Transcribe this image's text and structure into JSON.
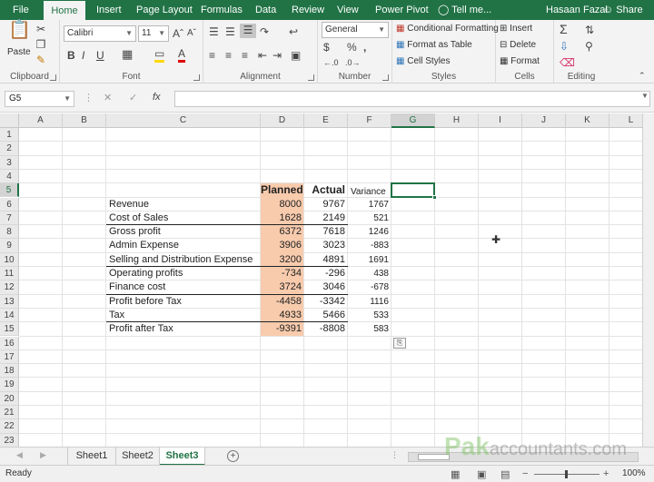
{
  "tabs": {
    "file": "File",
    "home": "Home",
    "insert": "Insert",
    "page_layout": "Page Layout",
    "formulas": "Formulas",
    "data": "Data",
    "review": "Review",
    "view": "View",
    "power_pivot": "Power Pivot",
    "tell_me": "Tell me...",
    "user": "Hasaan Fazal",
    "share": "Share"
  },
  "ribbon": {
    "clipboard": {
      "label": "Clipboard",
      "paste": "Paste"
    },
    "font": {
      "label": "Font",
      "font_name": "Calibri",
      "font_size": "11",
      "bold": "B",
      "italic": "I",
      "underline": "U"
    },
    "alignment": {
      "label": "Alignment"
    },
    "number": {
      "label": "Number",
      "format": "General",
      "currency": "$",
      "percent": "%",
      "comma": ","
    },
    "styles": {
      "label": "Styles",
      "conditional": "Conditional Formatting",
      "format_table": "Format as Table",
      "cell_styles": "Cell Styles"
    },
    "cells": {
      "label": "Cells",
      "insert": "Insert",
      "delete": "Delete",
      "format": "Format"
    },
    "editing": {
      "label": "Editing"
    }
  },
  "formula_bar": {
    "name_box": "G5",
    "fx": "fx",
    "formula": ""
  },
  "grid": {
    "columns": [
      "A",
      "B",
      "C",
      "D",
      "E",
      "F",
      "G",
      "H",
      "I",
      "J",
      "K",
      "L"
    ],
    "selected_column": "G",
    "rows": [
      "1",
      "2",
      "3",
      "4",
      "5",
      "6",
      "7",
      "8",
      "9",
      "10",
      "11",
      "12",
      "13",
      "14",
      "15",
      "16",
      "17",
      "18",
      "19",
      "20",
      "21",
      "22",
      "23"
    ],
    "selected_row": "5",
    "headers": {
      "planned": "Planned",
      "actual": "Actual",
      "variance": "Variance"
    },
    "table": [
      {
        "label": "Revenue",
        "planned": "8000",
        "actual": "9767",
        "variance": "1767"
      },
      {
        "label": "Cost of Sales",
        "planned": "1628",
        "actual": "2149",
        "variance": "521"
      },
      {
        "label": "Gross profit",
        "planned": "6372",
        "actual": "7618",
        "variance": "1246"
      },
      {
        "label": "Admin Expense",
        "planned": "3906",
        "actual": "3023",
        "variance": "-883"
      },
      {
        "label": "Selling and Distribution Expense",
        "planned": "3200",
        "actual": "4891",
        "variance": "1691"
      },
      {
        "label": "Operating profits",
        "planned": "-734",
        "actual": "-296",
        "variance": "438"
      },
      {
        "label": "Finance cost",
        "planned": "3724",
        "actual": "3046",
        "variance": "-678"
      },
      {
        "label": "Profit before Tax",
        "planned": "-4458",
        "actual": "-3342",
        "variance": "1116"
      },
      {
        "label": "Tax",
        "planned": "4933",
        "actual": "5466",
        "variance": "533"
      },
      {
        "label": "Profit after Tax",
        "planned": "-9391",
        "actual": "-8808",
        "variance": "583"
      }
    ],
    "planned_fill_color": "#f8cbad"
  },
  "sheets": [
    "Sheet1",
    "Sheet2",
    "Sheet3"
  ],
  "active_sheet": "Sheet3",
  "watermark": {
    "brand": "Pak",
    "rest": "accountants.com"
  },
  "status": {
    "ready": "Ready",
    "zoom": "100%"
  },
  "accent_color": "#217346"
}
